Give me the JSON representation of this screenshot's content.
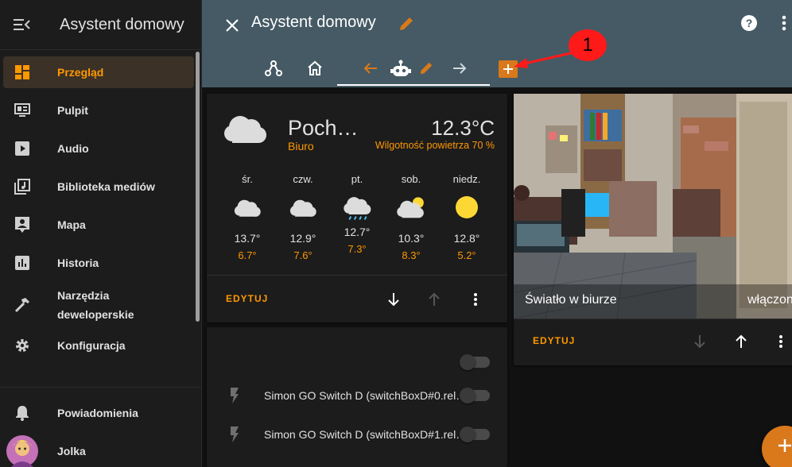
{
  "sidebar": {
    "title": "Asystent domowy",
    "items": [
      {
        "label": "Przegląd",
        "icon": "dashboard-icon"
      },
      {
        "label": "Pulpit",
        "icon": "monitor-dashboard-icon"
      },
      {
        "label": "Audio",
        "icon": "play-box-icon"
      },
      {
        "label": "Biblioteka mediów",
        "icon": "media-library-icon"
      },
      {
        "label": "Mapa",
        "icon": "account-map-icon"
      },
      {
        "label": "Historia",
        "icon": "chart-bar-icon"
      },
      {
        "label_line1": "Narzędzia",
        "label_line2": "deweloperskie",
        "icon": "hammer-icon"
      },
      {
        "label": "Konfiguracja",
        "icon": "cog-icon"
      },
      {
        "label": "Powiadomienia",
        "icon": "bell-icon"
      },
      {
        "label": "Jolka",
        "icon": "avatar"
      }
    ]
  },
  "header": {
    "title": "Asystent domowy",
    "callout_number": "1"
  },
  "weather": {
    "condition": "Poch…",
    "location": "Biuro",
    "temperature": "12.3°C",
    "humidity": "Wilgotność powietrza 70 %",
    "forecast": [
      {
        "day": "śr.",
        "high": "13.7°",
        "low": "6.7°",
        "icon": "cloudy-icon"
      },
      {
        "day": "czw.",
        "high": "12.9°",
        "low": "7.6°",
        "icon": "cloudy-icon"
      },
      {
        "day": "pt.",
        "high": "12.7°",
        "low": "7.3°",
        "icon": "rainy-icon"
      },
      {
        "day": "sob.",
        "high": "10.3°",
        "low": "8.3°",
        "icon": "partly-cloudy-icon"
      },
      {
        "day": "niedz.",
        "high": "12.8°",
        "low": "5.2°",
        "icon": "sunny-icon"
      }
    ],
    "edit_label": "EDYTUJ"
  },
  "entities": [
    {
      "name": ""
    },
    {
      "name": "Simon GO Switch D (switchBoxD#0.rel…"
    },
    {
      "name": "Simon GO Switch D (switchBoxD#1.rel…"
    }
  ],
  "camera": {
    "name": "Światło w biurze",
    "state": "włączone",
    "edit_label": "EDYTUJ"
  },
  "colors": {
    "accent": "#ff9800",
    "header": "#455a64",
    "sidebar": "#1c1c1c",
    "callout": "#ff1a1a"
  }
}
